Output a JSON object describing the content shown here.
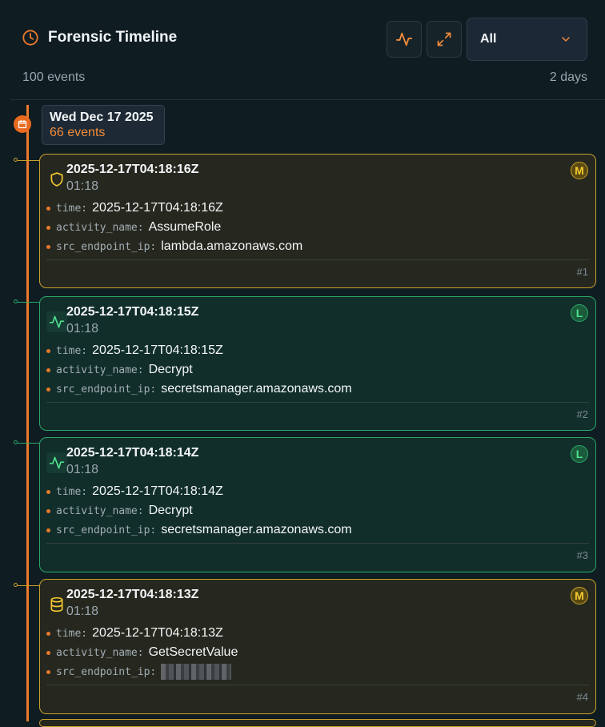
{
  "header": {
    "title": "Forensic Timeline",
    "event_count": "100 events",
    "span": "2 days",
    "filter": {
      "selected": "All"
    },
    "colors": {
      "accent": "#ea7a2b",
      "medium": "#c9a22a",
      "low": "#2aa86a"
    }
  },
  "date_group": {
    "label": "Wed Dec 17 2025",
    "count": "66 events"
  },
  "events": [
    {
      "timestamp": "2025-12-17T04:18:16Z",
      "time": "01:18",
      "severity": "M",
      "icon": "shield-icon",
      "fields": [
        {
          "key": "time:",
          "value": "2025-12-17T04:18:16Z"
        },
        {
          "key": "activity_name:",
          "value": "AssumeRole"
        },
        {
          "key": "src_endpoint_ip:",
          "value": "lambda.amazonaws.com"
        }
      ],
      "number": "#1"
    },
    {
      "timestamp": "2025-12-17T04:18:15Z",
      "time": "01:18",
      "severity": "L",
      "icon": "activity-icon",
      "fields": [
        {
          "key": "time:",
          "value": "2025-12-17T04:18:15Z"
        },
        {
          "key": "activity_name:",
          "value": "Decrypt"
        },
        {
          "key": "src_endpoint_ip:",
          "value": "secretsmanager.amazonaws.com"
        }
      ],
      "number": "#2"
    },
    {
      "timestamp": "2025-12-17T04:18:14Z",
      "time": "01:18",
      "severity": "L",
      "icon": "activity-icon",
      "fields": [
        {
          "key": "time:",
          "value": "2025-12-17T04:18:14Z"
        },
        {
          "key": "activity_name:",
          "value": "Decrypt"
        },
        {
          "key": "src_endpoint_ip:",
          "value": "secretsmanager.amazonaws.com"
        }
      ],
      "number": "#3"
    },
    {
      "timestamp": "2025-12-17T04:18:13Z",
      "time": "01:18",
      "severity": "M",
      "icon": "database-icon",
      "fields": [
        {
          "key": "time:",
          "value": "2025-12-17T04:18:13Z"
        },
        {
          "key": "activity_name:",
          "value": "GetSecretValue"
        },
        {
          "key": "src_endpoint_ip:",
          "value": ""
        }
      ],
      "number": "#4"
    }
  ]
}
